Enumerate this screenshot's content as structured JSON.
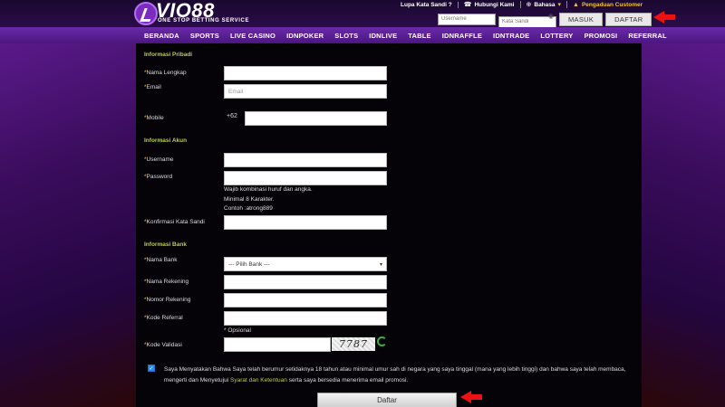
{
  "brand": {
    "name": "VIO88",
    "tagline": "ONE STOP BETTING SERVICE"
  },
  "toplinks": {
    "forgot": "Lupa Kata Sandi ?",
    "contact": "Hubungi Kami",
    "language": "Bahasa",
    "complaint": "Pengaduan Customer"
  },
  "login": {
    "username_placeholder": "Username",
    "password_placeholder": "Kata Sandi",
    "login_label": "MASUK",
    "register_label": "DAFTAR"
  },
  "nav": [
    "BERANDA",
    "SPORTS",
    "LIVE CASINO",
    "IDNPOKER",
    "SLOTS",
    "IDNLIVE",
    "TABLE",
    "IDNRAFFLE",
    "IDNTRADE",
    "LOTTERY",
    "PROMOSI",
    "REFERRAL"
  ],
  "form": {
    "section_personal": "Informasi Pribadi",
    "full_name_label": "Nama Lengkap",
    "email_label": "Email",
    "email_placeholder": "Email",
    "mobile_label": "Mobile",
    "mobile_prefix": "+62",
    "section_account": "Informasi Akun",
    "username_label": "Username",
    "password_label": "Password",
    "password_hint_1": "Wajib kombinasi huruf dan angka.",
    "password_hint_2": "Minimal 8 Karakter.",
    "password_hint_3": "Contoh :atrong889",
    "confirm_label": "Konfirmasi Kata Sandi",
    "section_bank": "Informasi Bank",
    "bank_name_label": "Nama Bank",
    "bank_select_value": "--- Pilih Bank ---",
    "account_name_label": "Nama Rekening",
    "account_number_label": "Nomor Rekening",
    "referral_label": "Kode Referral",
    "optional_hint": "* Opsional",
    "validation_label": "Kode Validasi",
    "captcha_text": "7787",
    "terms_text_1": "Saya Menyatakan Bahwa Saya telah berumur setidaknya 18 tahun atau minimal umur sah di negara yang saya tinggal (mana yang lebih tinggi) dan bahwa saya telah membaca, mengerti dan Menyetujui ",
    "terms_link": "Syarat dan Ketentuan",
    "terms_text_2": " serta saya bersedia menerima email promosi.",
    "submit_label": "Daftar"
  },
  "colors": {
    "accent": "#b8d040",
    "arrow": "#e11111",
    "nav": "#5a1f94"
  }
}
